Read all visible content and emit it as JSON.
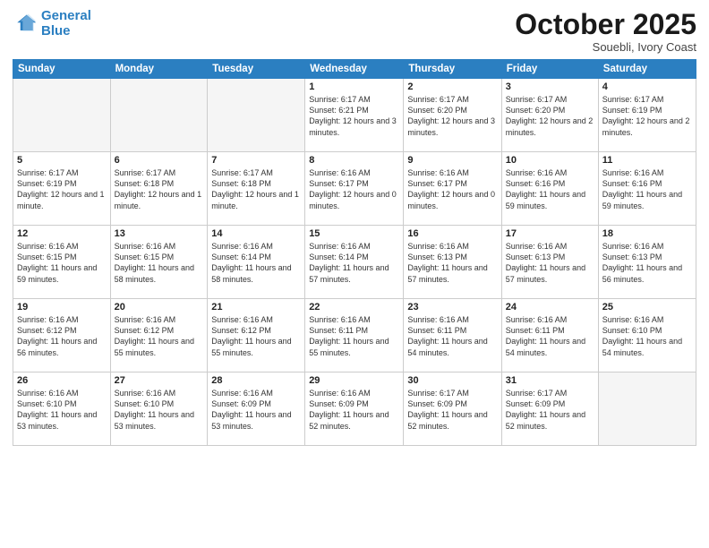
{
  "logo": {
    "line1": "General",
    "line2": "Blue"
  },
  "title": "October 2025",
  "subtitle": "Souebli, Ivory Coast",
  "days_of_week": [
    "Sunday",
    "Monday",
    "Tuesday",
    "Wednesday",
    "Thursday",
    "Friday",
    "Saturday"
  ],
  "weeks": [
    [
      {
        "day": "",
        "info": ""
      },
      {
        "day": "",
        "info": ""
      },
      {
        "day": "",
        "info": ""
      },
      {
        "day": "1",
        "info": "Sunrise: 6:17 AM\nSunset: 6:21 PM\nDaylight: 12 hours and 3 minutes."
      },
      {
        "day": "2",
        "info": "Sunrise: 6:17 AM\nSunset: 6:20 PM\nDaylight: 12 hours and 3 minutes."
      },
      {
        "day": "3",
        "info": "Sunrise: 6:17 AM\nSunset: 6:20 PM\nDaylight: 12 hours and 2 minutes."
      },
      {
        "day": "4",
        "info": "Sunrise: 6:17 AM\nSunset: 6:19 PM\nDaylight: 12 hours and 2 minutes."
      }
    ],
    [
      {
        "day": "5",
        "info": "Sunrise: 6:17 AM\nSunset: 6:19 PM\nDaylight: 12 hours and 1 minute."
      },
      {
        "day": "6",
        "info": "Sunrise: 6:17 AM\nSunset: 6:18 PM\nDaylight: 12 hours and 1 minute."
      },
      {
        "day": "7",
        "info": "Sunrise: 6:17 AM\nSunset: 6:18 PM\nDaylight: 12 hours and 1 minute."
      },
      {
        "day": "8",
        "info": "Sunrise: 6:16 AM\nSunset: 6:17 PM\nDaylight: 12 hours and 0 minutes."
      },
      {
        "day": "9",
        "info": "Sunrise: 6:16 AM\nSunset: 6:17 PM\nDaylight: 12 hours and 0 minutes."
      },
      {
        "day": "10",
        "info": "Sunrise: 6:16 AM\nSunset: 6:16 PM\nDaylight: 11 hours and 59 minutes."
      },
      {
        "day": "11",
        "info": "Sunrise: 6:16 AM\nSunset: 6:16 PM\nDaylight: 11 hours and 59 minutes."
      }
    ],
    [
      {
        "day": "12",
        "info": "Sunrise: 6:16 AM\nSunset: 6:15 PM\nDaylight: 11 hours and 59 minutes."
      },
      {
        "day": "13",
        "info": "Sunrise: 6:16 AM\nSunset: 6:15 PM\nDaylight: 11 hours and 58 minutes."
      },
      {
        "day": "14",
        "info": "Sunrise: 6:16 AM\nSunset: 6:14 PM\nDaylight: 11 hours and 58 minutes."
      },
      {
        "day": "15",
        "info": "Sunrise: 6:16 AM\nSunset: 6:14 PM\nDaylight: 11 hours and 57 minutes."
      },
      {
        "day": "16",
        "info": "Sunrise: 6:16 AM\nSunset: 6:13 PM\nDaylight: 11 hours and 57 minutes."
      },
      {
        "day": "17",
        "info": "Sunrise: 6:16 AM\nSunset: 6:13 PM\nDaylight: 11 hours and 57 minutes."
      },
      {
        "day": "18",
        "info": "Sunrise: 6:16 AM\nSunset: 6:13 PM\nDaylight: 11 hours and 56 minutes."
      }
    ],
    [
      {
        "day": "19",
        "info": "Sunrise: 6:16 AM\nSunset: 6:12 PM\nDaylight: 11 hours and 56 minutes."
      },
      {
        "day": "20",
        "info": "Sunrise: 6:16 AM\nSunset: 6:12 PM\nDaylight: 11 hours and 55 minutes."
      },
      {
        "day": "21",
        "info": "Sunrise: 6:16 AM\nSunset: 6:12 PM\nDaylight: 11 hours and 55 minutes."
      },
      {
        "day": "22",
        "info": "Sunrise: 6:16 AM\nSunset: 6:11 PM\nDaylight: 11 hours and 55 minutes."
      },
      {
        "day": "23",
        "info": "Sunrise: 6:16 AM\nSunset: 6:11 PM\nDaylight: 11 hours and 54 minutes."
      },
      {
        "day": "24",
        "info": "Sunrise: 6:16 AM\nSunset: 6:11 PM\nDaylight: 11 hours and 54 minutes."
      },
      {
        "day": "25",
        "info": "Sunrise: 6:16 AM\nSunset: 6:10 PM\nDaylight: 11 hours and 54 minutes."
      }
    ],
    [
      {
        "day": "26",
        "info": "Sunrise: 6:16 AM\nSunset: 6:10 PM\nDaylight: 11 hours and 53 minutes."
      },
      {
        "day": "27",
        "info": "Sunrise: 6:16 AM\nSunset: 6:10 PM\nDaylight: 11 hours and 53 minutes."
      },
      {
        "day": "28",
        "info": "Sunrise: 6:16 AM\nSunset: 6:09 PM\nDaylight: 11 hours and 53 minutes."
      },
      {
        "day": "29",
        "info": "Sunrise: 6:16 AM\nSunset: 6:09 PM\nDaylight: 11 hours and 52 minutes."
      },
      {
        "day": "30",
        "info": "Sunrise: 6:17 AM\nSunset: 6:09 PM\nDaylight: 11 hours and 52 minutes."
      },
      {
        "day": "31",
        "info": "Sunrise: 6:17 AM\nSunset: 6:09 PM\nDaylight: 11 hours and 52 minutes."
      },
      {
        "day": "",
        "info": ""
      }
    ]
  ]
}
